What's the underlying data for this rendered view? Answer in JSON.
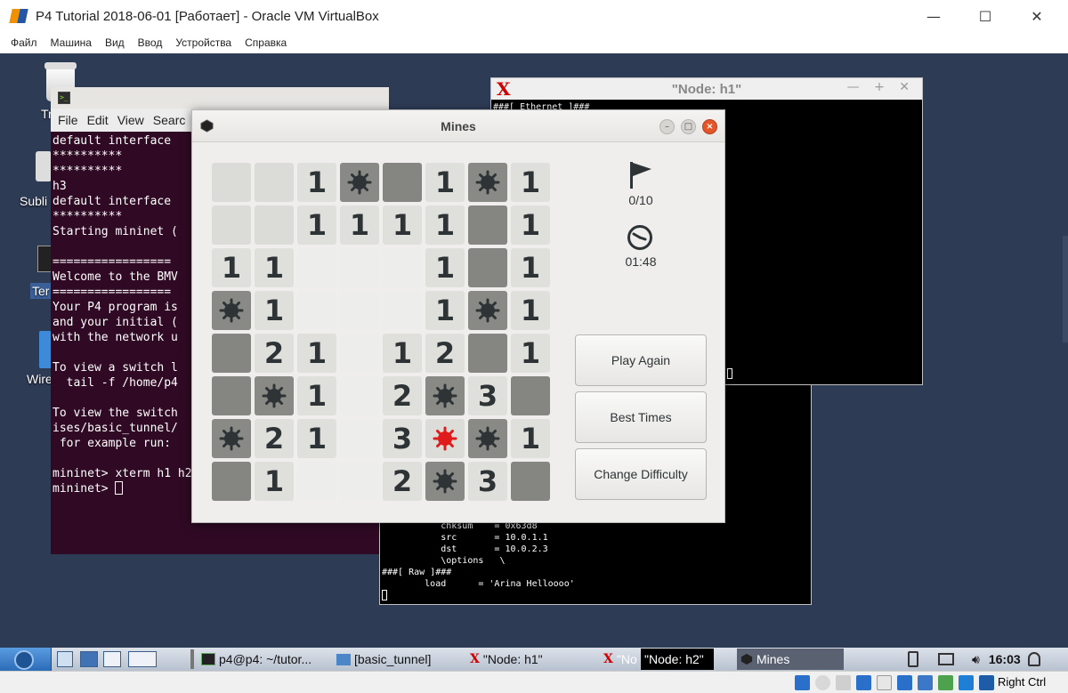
{
  "host_window": {
    "title": "P4 Tutorial 2018-06-01 [Работает] - Oracle VM VirtualBox",
    "minimize_glyph": "—",
    "maximize_glyph": "☐",
    "close_glyph": "✕",
    "menu": [
      "Файл",
      "Машина",
      "Вид",
      "Ввод",
      "Устройства",
      "Справка"
    ]
  },
  "desktop": {
    "icons": [
      {
        "label": "Trash",
        "icon": "trash-icon"
      },
      {
        "label": "Subli",
        "icon": "sublime-icon"
      },
      {
        "label": "Ter",
        "icon": "terminal-icon"
      },
      {
        "label": "Wire",
        "icon": "wireshark-icon"
      }
    ]
  },
  "terminal": {
    "menu": [
      "File",
      "Edit",
      "View",
      "Searc"
    ],
    "lines": [
      "default interface",
      "**********",
      "**********",
      "h3",
      "default interface",
      "**********",
      "Starting mininet (",
      "",
      "=================",
      "Welcome to the BMV",
      "=================",
      "Your P4 program is",
      "and your initial (",
      "with the network u",
      "",
      "To view a switch l",
      "  tail -f /home/p4",
      "",
      "To view the switch",
      "ises/basic_tunnel/",
      " for example run:",
      "",
      "mininet> xterm h1 h2",
      "mininet> "
    ]
  },
  "xterm_h1": {
    "title": "\"Node: h1\"",
    "controls": "— + ✕",
    "first_line": "###[ Ethernet ]###"
  },
  "xterm_h2": {
    "lines": [
      "           chksum    = 0x63d8",
      "           src       = 10.0.1.1",
      "           dst       = 10.0.2.3",
      "           \\options   \\",
      "###[ Raw ]###",
      "        load      = 'Arina Helloooo'"
    ]
  },
  "mines": {
    "title": "Mines",
    "flags": "0/10",
    "time": "01:48",
    "buttons": {
      "play_again": "Play Again",
      "best_times": "Best Times",
      "change_difficulty": "Change Difficulty"
    },
    "board": [
      [
        "u",
        "u",
        "1",
        "m",
        "p",
        "1",
        "m",
        "1"
      ],
      [
        "u",
        "u",
        "1",
        "1",
        "1",
        "1",
        "p",
        "1"
      ],
      [
        "1",
        "1",
        "r",
        "r",
        "r",
        "1",
        "p",
        "1"
      ],
      [
        "m",
        "1",
        "r",
        "r",
        "r",
        "1",
        "m",
        "1"
      ],
      [
        "p",
        "2",
        "1",
        "r",
        "1",
        "2",
        "p",
        "1"
      ],
      [
        "p",
        "m",
        "1",
        "r",
        "2",
        "m",
        "3",
        "p"
      ],
      [
        "m",
        "2",
        "1",
        "r",
        "3",
        "x",
        "m",
        "1"
      ],
      [
        "p",
        "1",
        "r",
        "r",
        "2",
        "m",
        "3",
        "p"
      ]
    ]
  },
  "taskbar": {
    "tasks": [
      {
        "label": "p4@p4: ~/tutor...",
        "icon": "terminal-icon"
      },
      {
        "label": "[basic_tunnel]",
        "icon": "folder-icon"
      },
      {
        "label": "\"Node: h1\"",
        "icon": "xterm-icon"
      },
      {
        "label": "\"No",
        "icon": "xterm-icon"
      },
      {
        "label": "\"Node: h2\"",
        "icon": "",
        "active": true
      },
      {
        "label": "Mines",
        "icon": "mines-icon"
      }
    ],
    "clock": "16:03"
  },
  "statusbar": {
    "host_key": "Right Ctrl"
  },
  "colors": {
    "desktop": "#2e3b55",
    "terminal_bg": "#300a24",
    "mine_red": "#e01b1b",
    "close_button": "#e4562a"
  }
}
